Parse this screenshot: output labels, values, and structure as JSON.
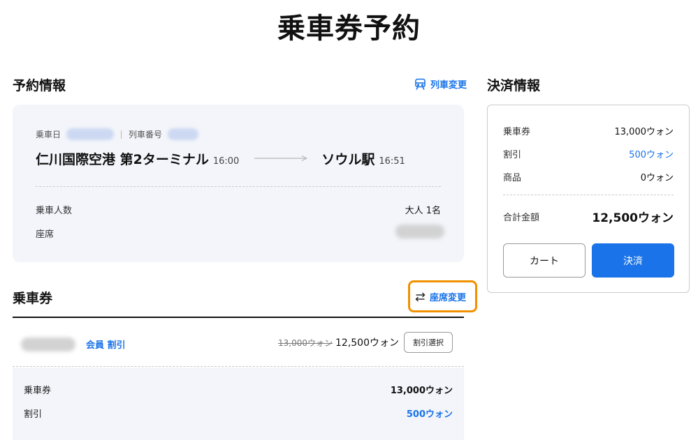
{
  "page": {
    "title": "乗車券予約"
  },
  "reservation": {
    "section_title": "予約情報",
    "change_train_label": "列車変更",
    "boarding_date_label": "乗車日",
    "train_number_label": "列車番号",
    "departure_station": "仁川国際空港 第2ターミナル",
    "departure_time": "16:00",
    "arrival_station": "ソウル駅",
    "arrival_time": "16:51",
    "passenger_label": "乗車人数",
    "passenger_value": "大人 1名",
    "seat_label": "座席"
  },
  "ticket": {
    "section_title": "乗車券",
    "change_seat_label": "座席変更",
    "discount_type": "会員 割引",
    "original_price": "13,000ウォン",
    "discounted_price": "12,500ウォン",
    "discount_select_label": "割引選択",
    "summary": {
      "ticket_label": "乗車券",
      "ticket_value": "13,000ウォン",
      "discount_label": "割引",
      "discount_value": "500ウォン"
    }
  },
  "payment": {
    "section_title": "決済情報",
    "ticket_label": "乗車券",
    "ticket_value": "13,000ウォン",
    "discount_label": "割引",
    "discount_value": "500ウォン",
    "goods_label": "商品",
    "goods_value": "0ウォン",
    "total_label": "合計金額",
    "total_value": "12,500ウォン",
    "cart_label": "カート",
    "pay_label": "決済"
  },
  "colors": {
    "accent": "#1a73e8",
    "highlight": "#f29100",
    "card_bg": "#f3f5fa"
  },
  "icons": {
    "change_train": "train-icon",
    "change_seat": "swap-arrows-icon"
  }
}
